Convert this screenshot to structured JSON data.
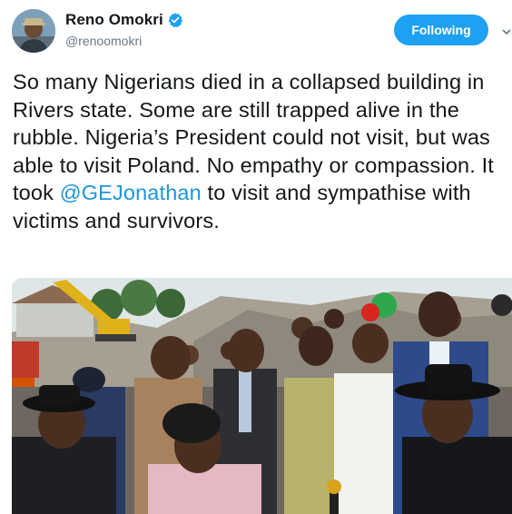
{
  "author": {
    "display_name": "Reno Omokri",
    "handle": "@renoomokri",
    "verified": true
  },
  "follow_button": {
    "label": "Following"
  },
  "tweet": {
    "text_before_mention": "So many Nigerians died in a collapsed building in Rivers state. Some are still trapped alive in the rubble. Nigeria’s President could not visit, but was able to visit Poland. No empathy or compassion. It took ",
    "mention": "@GEJonathan",
    "text_after_mention": " to visit and sympathise with victims and survivors."
  },
  "icons": {
    "verified": "verified-badge-icon",
    "menu": "chevron-down-icon"
  },
  "colors": {
    "accent": "#1da1f2",
    "link": "#1b95e0",
    "text": "#14171a",
    "secondary_text": "#657786"
  }
}
